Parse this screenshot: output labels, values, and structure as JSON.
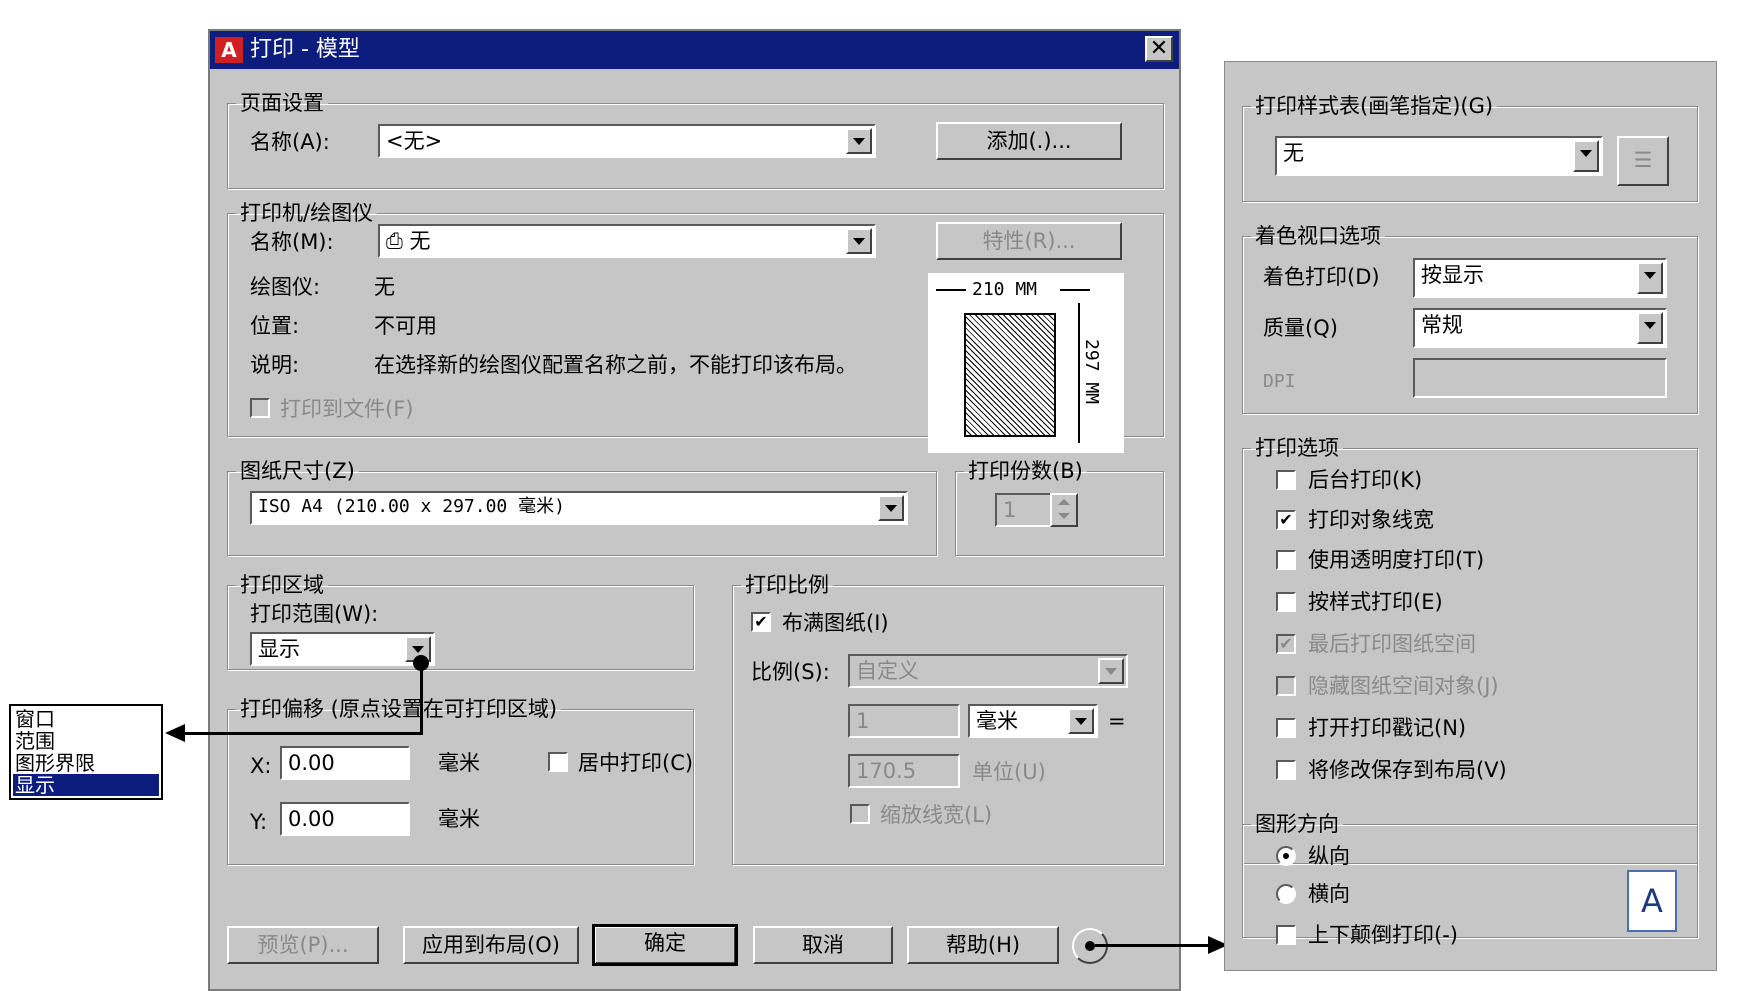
{
  "dialog": {
    "title": "打印 - 模型",
    "page_setup": {
      "legend": "页面设置",
      "name_label": "名称(A):",
      "name_value": "<无>",
      "add_button": "添加(.)..."
    },
    "printer": {
      "legend": "打印机/绘图仪",
      "name_label": "名称(M):",
      "name_value": "无",
      "properties_button": "特性(R)...",
      "plotter_label": "绘图仪:",
      "plotter_value": "无",
      "location_label": "位置:",
      "location_value": "不可用",
      "description_label": "说明:",
      "description_value": "在选择新的绘图仪配置名称之前，不能打印该布局。",
      "plot_to_file": "打印到文件(F)",
      "preview_width": "210 MM",
      "preview_height": "297 MM"
    },
    "paper_size": {
      "legend": "图纸尺寸(Z)",
      "value": "ISO A4 (210.00 x 297.00 毫米)"
    },
    "copies": {
      "legend": "打印份数(B)",
      "value": "1"
    },
    "plot_area": {
      "legend": "打印区域",
      "range_label": "打印范围(W):",
      "range_value": "显示"
    },
    "plot_scale": {
      "legend": "打印比例",
      "fit_to_paper": "布满图纸(I)",
      "fit_to_paper_checked": true,
      "scale_label": "比例(S):",
      "scale_value": "自定义",
      "scale_num": "1",
      "unit_value": "毫米",
      "equals": "=",
      "scale_den": "170.5",
      "units_label": "单位(U)",
      "scale_lineweights": "缩放线宽(L)"
    },
    "plot_offset": {
      "legend": "打印偏移 (原点设置在可打印区域)",
      "x_label": "X:",
      "x_value": "0.00",
      "x_unit": "毫米",
      "y_label": "Y:",
      "y_value": "0.00",
      "y_unit": "毫米",
      "center_plot": "居中打印(C)"
    },
    "buttons": {
      "preview": "预览(P)...",
      "apply_to_layout": "应用到布局(O)",
      "ok": "确定",
      "cancel": "取消",
      "help": "帮助(H)"
    }
  },
  "range_list": {
    "options": [
      "窗口",
      "范围",
      "图形界限",
      "显示"
    ],
    "selected_index": 3
  },
  "panel": {
    "style_table": {
      "legend": "打印样式表(画笔指定)(G)",
      "value": "无"
    },
    "shaded_viewport": {
      "legend": "着色视口选项",
      "shade_label": "着色打印(D)",
      "shade_value": "按显示",
      "quality_label": "质量(Q)",
      "quality_value": "常规",
      "dpi_label": "DPI"
    },
    "plot_options": {
      "legend": "打印选项",
      "items": [
        {
          "label": "后台打印(K)",
          "checked": false,
          "disabled": false
        },
        {
          "label": "打印对象线宽",
          "checked": true,
          "disabled": false
        },
        {
          "label": "使用透明度打印(T)",
          "checked": false,
          "disabled": false
        },
        {
          "label": "按样式打印(E)",
          "checked": false,
          "disabled": false
        },
        {
          "label": "最后打印图纸空间",
          "checked": true,
          "disabled": true
        },
        {
          "label": "隐藏图纸空间对象(J)",
          "checked": false,
          "disabled": true
        },
        {
          "label": "打开打印戳记(N)",
          "checked": false,
          "disabled": false
        },
        {
          "label": "将修改保存到布局(V)",
          "checked": false,
          "disabled": false
        }
      ]
    },
    "orientation": {
      "legend": "图形方向",
      "portrait": "纵向",
      "landscape": "横向",
      "upside_down": "上下颠倒打印(-)",
      "icon_letter": "A"
    }
  },
  "colors": {
    "titlebar": "#0c1d7e",
    "dialog_bg": "#c6c6c6",
    "selection": "#0c1d7e"
  }
}
